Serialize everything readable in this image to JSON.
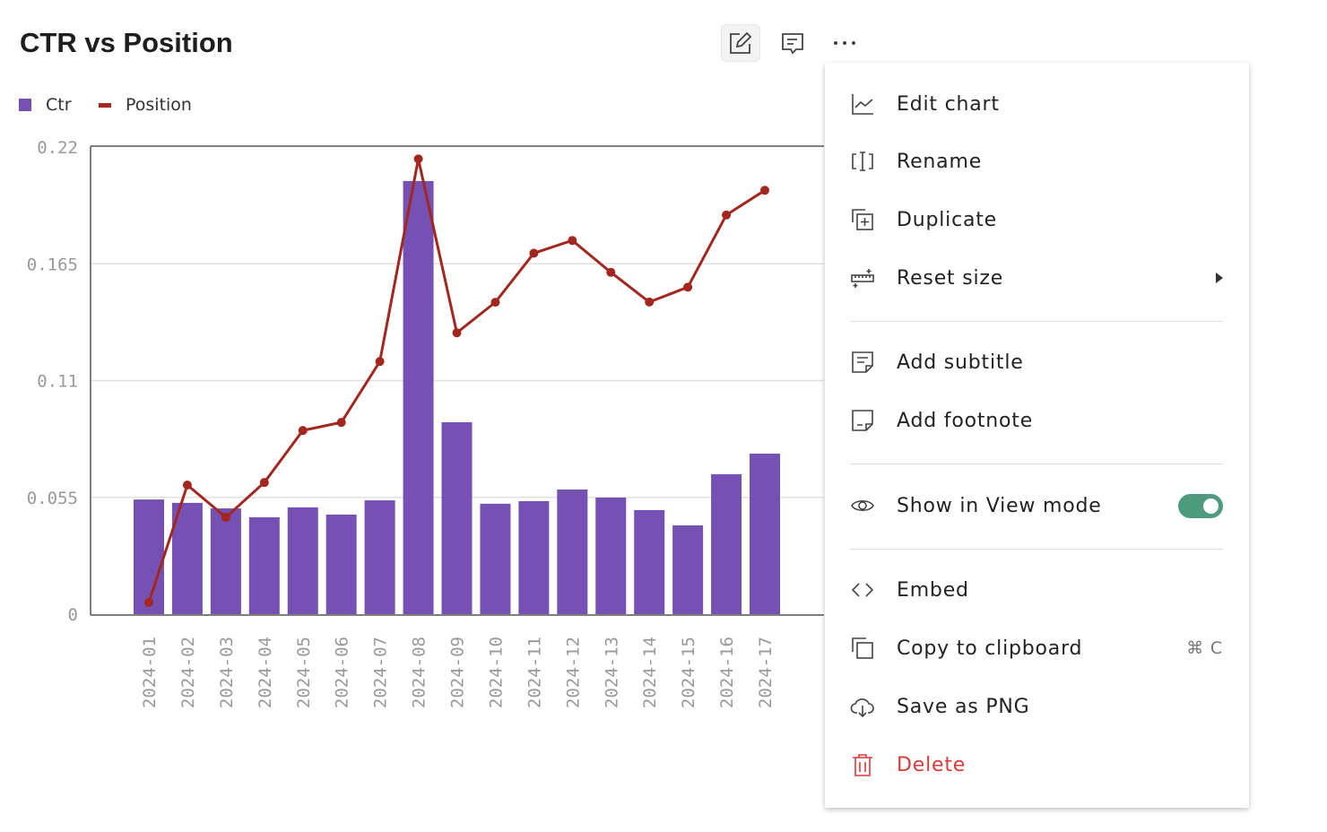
{
  "title": "CTR vs Position",
  "toolbar": {
    "edit_icon": "pencil-square-icon",
    "comment_icon": "comment-icon",
    "more_icon": "ellipsis-icon"
  },
  "chart_data": {
    "type": "bar+line",
    "categories": [
      "2024-01",
      "2024-02",
      "2024-03",
      "2024-04",
      "2024-05",
      "2024-06",
      "2024-07",
      "2024-08",
      "2024-09",
      "2024-10",
      "2024-11",
      "2024-12",
      "2024-13",
      "2024-14",
      "2024-15",
      "2024-16",
      "2024-17"
    ],
    "series": [
      {
        "name": "Ctr",
        "type": "bar",
        "color": "#7651b4",
        "values": [
          0.054,
          0.0524,
          0.0498,
          0.0456,
          0.0503,
          0.0469,
          0.0536,
          0.204,
          0.0904,
          0.052,
          0.0532,
          0.0587,
          0.0549,
          0.049,
          0.0418,
          0.0659,
          0.0756
        ]
      },
      {
        "name": "Position",
        "type": "line",
        "color": "#a3271f",
        "values": [
          0.0055,
          0.0608,
          0.0456,
          0.062,
          0.0865,
          0.0903,
          0.119,
          0.2144,
          0.1325,
          0.1469,
          0.17,
          0.176,
          0.161,
          0.147,
          0.154,
          0.188,
          0.1996
        ]
      }
    ],
    "yticks": [
      "0",
      "0.055",
      "0.11",
      "0.165",
      "0.22"
    ],
    "ylim": [
      0,
      0.22
    ],
    "grid": true,
    "legend": "top-left"
  },
  "menu": {
    "items": [
      {
        "label": "Edit chart",
        "icon": "line-chart-icon"
      },
      {
        "label": "Rename",
        "icon": "rename-icon"
      },
      {
        "label": "Duplicate",
        "icon": "duplicate-icon"
      },
      {
        "label": "Reset size",
        "icon": "ruler-icon",
        "submenu": true
      },
      {
        "label": "Add subtitle",
        "icon": "subtitle-icon"
      },
      {
        "label": "Add footnote",
        "icon": "footnote-icon"
      },
      {
        "label": "Show in View mode",
        "icon": "eye-icon",
        "toggle": true
      },
      {
        "label": "Embed",
        "icon": "code-icon"
      },
      {
        "label": "Copy to clipboard",
        "icon": "copy-icon",
        "shortcut": "⌘ C"
      },
      {
        "label": "Save as PNG",
        "icon": "cloud-download-icon"
      },
      {
        "label": "Delete",
        "icon": "trash-icon",
        "color": "#da3a3a"
      }
    ]
  }
}
